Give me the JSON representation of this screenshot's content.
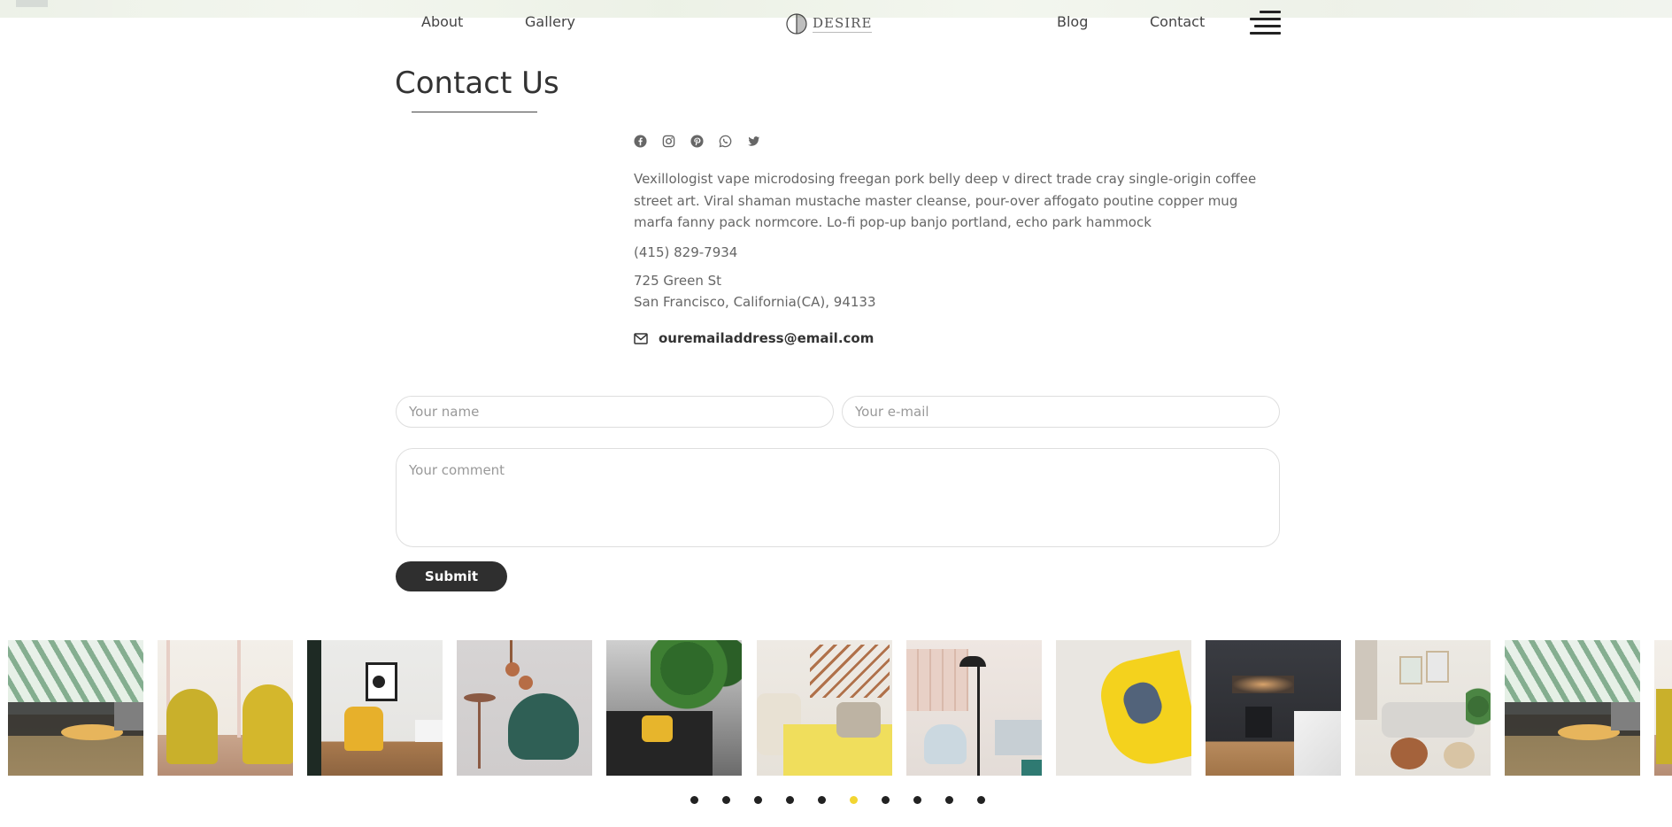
{
  "nav": {
    "left_links": [
      "About",
      "Gallery"
    ],
    "right_links": [
      "Blog",
      "Contact"
    ],
    "logo_text": "DESIRE"
  },
  "page": {
    "title": "Contact Us"
  },
  "contact": {
    "socials": [
      "facebook-icon",
      "instagram-icon",
      "pinterest-icon",
      "whatsapp-icon",
      "twitter-icon"
    ],
    "description": "Vexillologist vape microdosing freegan pork belly deep v direct trade cray single-origin coffee street art. Viral shaman mustache master cleanse, pour-over affogato poutine copper mug marfa fanny pack normcore. Lo-fi pop-up banjo portland, echo park hammock",
    "phone": "(415) 829-7934",
    "address_line1": "725 Green St",
    "address_line2": "San Francisco, California(CA), 94133",
    "email": "ouremailaddress@email.com"
  },
  "form": {
    "name_placeholder": "Your name",
    "email_placeholder": "Your e-mail",
    "comment_placeholder": "Your comment",
    "submit_label": "Submit"
  },
  "gallery": {
    "images": [
      "living-room-green-wallpaper",
      "yellow-chairs-shelves",
      "yellow-armchair-dark-door",
      "green-lounge-chair",
      "monstera-yellow-sofa",
      "cream-sofa-stairs",
      "modern-lounge-lamp",
      "yellow-chair-top-view",
      "dark-kitchen",
      "grey-sofa-plants",
      "living-room-green-wallpaper"
    ],
    "active_dot": 5,
    "dot_count": 10
  },
  "colors": {
    "accent": "#f2d531",
    "button": "#2f2f2f",
    "text": "#333333",
    "muted": "#666666"
  }
}
